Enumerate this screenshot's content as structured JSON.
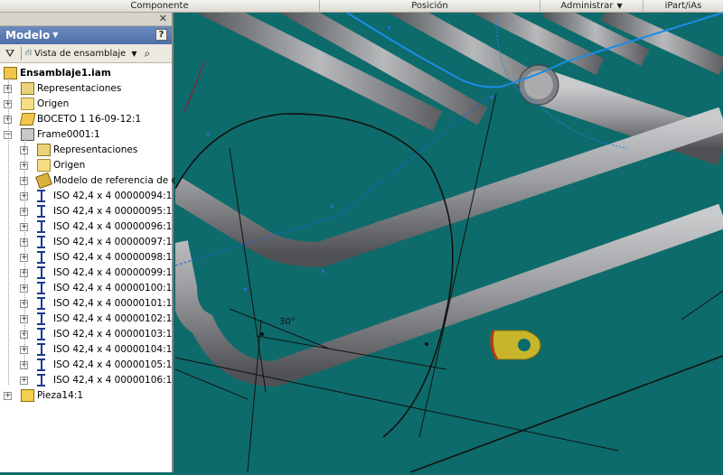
{
  "ribbon": {
    "tabs": [
      {
        "label": "Componente",
        "has_dropdown": false
      },
      {
        "label": "Posición",
        "has_dropdown": false
      },
      {
        "label": "Administrar",
        "has_dropdown": true
      },
      {
        "label": "iPart/iAs",
        "has_dropdown": false
      }
    ]
  },
  "browser": {
    "title": "Modelo",
    "help": "?",
    "view_label": "Vista de ensamblaje",
    "icons": {
      "filter": "filter-icon",
      "search": "binoculars-icon",
      "close": "close-icon"
    },
    "tree": [
      {
        "label": "Ensamblaje1.iam",
        "icon": "assembly-icon",
        "level": 0,
        "expander": "",
        "root": true
      },
      {
        "label": "Representaciones",
        "icon": "representations-icon",
        "level": 1,
        "expander": "+"
      },
      {
        "label": "Origen",
        "icon": "folder-icon",
        "level": 1,
        "expander": "+"
      },
      {
        "label": "BOCETO 1 16-09-12:1",
        "icon": "sketch-icon",
        "level": 1,
        "expander": "+"
      },
      {
        "label": "Frame0001:1",
        "icon": "frame-icon",
        "level": 1,
        "expander": "−"
      },
      {
        "label": "Representaciones",
        "icon": "representations-icon",
        "level": 2,
        "expander": "+"
      },
      {
        "label": "Origen",
        "icon": "folder-icon",
        "level": 2,
        "expander": "+"
      },
      {
        "label": "Modelo de referencia de estr",
        "icon": "reference-model-icon",
        "level": 2,
        "expander": "+"
      },
      {
        "label": "ISO 42,4 x 4 00000094:1",
        "icon": "beam-icon",
        "level": 2,
        "expander": "+"
      },
      {
        "label": "ISO 42,4 x 4 00000095:1",
        "icon": "beam-icon",
        "level": 2,
        "expander": "+"
      },
      {
        "label": "ISO 42,4 x 4 00000096:1",
        "icon": "beam-icon",
        "level": 2,
        "expander": "+"
      },
      {
        "label": "ISO 42,4 x 4 00000097:1",
        "icon": "beam-icon",
        "level": 2,
        "expander": "+"
      },
      {
        "label": "ISO 42,4 x 4 00000098:1",
        "icon": "beam-icon",
        "level": 2,
        "expander": "+"
      },
      {
        "label": "ISO 42,4 x 4 00000099:1",
        "icon": "beam-icon",
        "level": 2,
        "expander": "+"
      },
      {
        "label": "ISO 42,4 x 4 00000100:1",
        "icon": "beam-icon",
        "level": 2,
        "expander": "+"
      },
      {
        "label": "ISO 42,4 x 4 00000101:1",
        "icon": "beam-icon",
        "level": 2,
        "expander": "+"
      },
      {
        "label": "ISO 42,4 x 4 00000102:1",
        "icon": "beam-icon",
        "level": 2,
        "expander": "+"
      },
      {
        "label": "ISO 42,4 x 4 00000103:1",
        "icon": "beam-icon",
        "level": 2,
        "expander": "+"
      },
      {
        "label": "ISO 42,4 x 4 00000104:1",
        "icon": "beam-icon",
        "level": 2,
        "expander": "+"
      },
      {
        "label": "ISO 42,4 x 4 00000105:1",
        "icon": "beam-icon",
        "level": 2,
        "expander": "+"
      },
      {
        "label": "ISO 42,4 x 4 00000106:1",
        "icon": "beam-icon",
        "level": 2,
        "expander": "+"
      },
      {
        "label": "Pieza14:1",
        "icon": "part-icon",
        "level": 1,
        "expander": "+"
      }
    ]
  },
  "viewport": {
    "angle_dimension": "30°",
    "background_color": "#0e6b6b",
    "tube_color": "#8d8f92",
    "sketch_line_color": "#1c8ce6",
    "part_color": "#c9b52a"
  }
}
